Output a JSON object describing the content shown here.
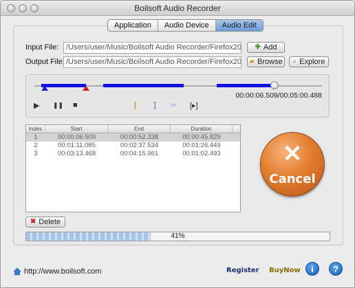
{
  "window": {
    "title": "Boilsoft Audio Recorder"
  },
  "tabs": [
    {
      "label": "Application"
    },
    {
      "label": "Audio Device"
    },
    {
      "label": "Audio Edit"
    }
  ],
  "input": {
    "label": "Input File:",
    "value": "/Users/user/Music/Boilsoft Audio Recorder/Firefox20120"
  },
  "output": {
    "label": "Output File:",
    "value": "/Users/user/Music/Boilsoft Audio Recorder/Firefox20120"
  },
  "buttons": {
    "add": "Add",
    "browse": "Browse",
    "explore": "Explore",
    "delete": "Delete",
    "cancel": "Cancel"
  },
  "player": {
    "timecode": "00:00:06.509/00:05:00.488",
    "play": "▶",
    "pause": "❚❚",
    "stop": "■",
    "set_start": "[",
    "set_end": "]",
    "cut": "✂",
    "go": "[▸]"
  },
  "table": {
    "columns": [
      "Index",
      "Start",
      "End",
      "Duration"
    ],
    "rows": [
      [
        "1",
        "00:00:06.509",
        "00:00:52.338",
        "00:00:45.829"
      ],
      [
        "2",
        "00:01:11.085",
        "00:02:37.534",
        "00:01:26.449"
      ],
      [
        "3",
        "00:03:13.468",
        "00:04:15.961",
        "00:01:02.493"
      ]
    ]
  },
  "progress": {
    "value": 0.41,
    "label": "41%"
  },
  "footer": {
    "url": "http://www.boilsoft.com",
    "register": "Register",
    "buynow": "BuyNow",
    "info_icon": "info-icon",
    "help_icon": "help-icon"
  },
  "colors": {
    "accent": "#1212e8",
    "cancel": "#e37d2e",
    "tab_active": "#6f9cd8"
  }
}
